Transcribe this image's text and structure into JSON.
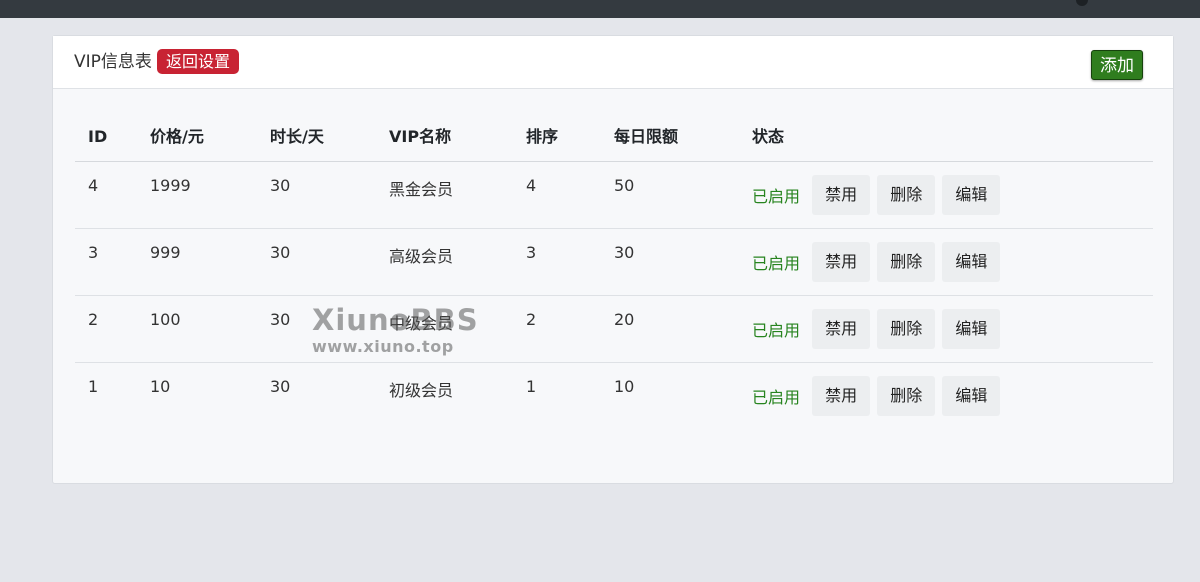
{
  "header": {
    "title": "VIP信息表",
    "return_label": "返回设置",
    "add_label": "添加"
  },
  "table": {
    "columns": [
      "ID",
      "价格/元",
      "时长/天",
      "VIP名称",
      "排序",
      "每日限额",
      "状态"
    ],
    "rows": [
      {
        "id": "4",
        "price": "1999",
        "days": "30",
        "name": "黑金会员",
        "sort": "4",
        "limit": "50",
        "status": "已启用",
        "disable": "禁用",
        "delete": "删除",
        "edit": "编辑"
      },
      {
        "id": "3",
        "price": "999",
        "days": "30",
        "name": "高级会员",
        "sort": "3",
        "limit": "30",
        "status": "已启用",
        "disable": "禁用",
        "delete": "删除",
        "edit": "编辑"
      },
      {
        "id": "2",
        "price": "100",
        "days": "30",
        "name": "中级会员",
        "sort": "2",
        "limit": "20",
        "status": "已启用",
        "disable": "禁用",
        "delete": "删除",
        "edit": "编辑"
      },
      {
        "id": "1",
        "price": "10",
        "days": "30",
        "name": "初级会员",
        "sort": "1",
        "limit": "10",
        "status": "已启用",
        "disable": "禁用",
        "delete": "删除",
        "edit": "编辑"
      }
    ]
  },
  "watermark": {
    "brand": "XiunoBBS",
    "url": "www.xiuno.top"
  },
  "colors": {
    "topbar": "#343a40",
    "return_badge": "#c82333",
    "add_button": "#2f7d1e",
    "status_enabled": "#27841f"
  }
}
